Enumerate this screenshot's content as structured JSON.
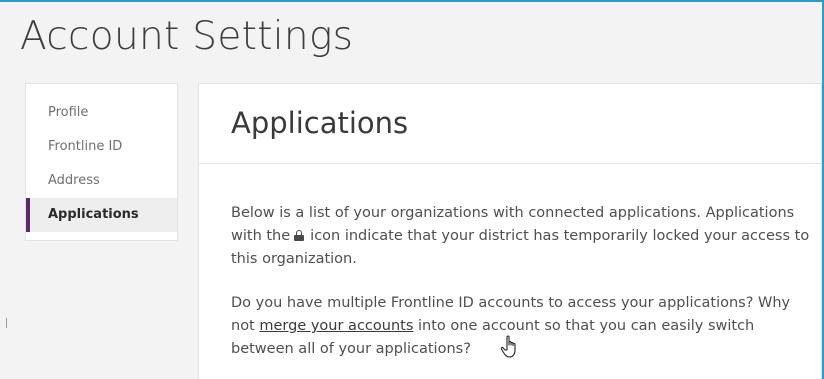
{
  "page": {
    "title": "Account Settings"
  },
  "sidebar": {
    "items": [
      {
        "label": "Profile",
        "active": false
      },
      {
        "label": "Frontline ID",
        "active": false
      },
      {
        "label": "Address",
        "active": false
      },
      {
        "label": "Applications",
        "active": true
      }
    ]
  },
  "panel": {
    "title": "Applications",
    "para1": {
      "before_icon": "Below is a list of your organizations with connected applications. Applications with the",
      "icon": "lock-icon",
      "after_icon": "icon indicate that your district has temporarily locked your access to this organization."
    },
    "para2": {
      "before_link": "Do you have multiple Frontline ID accounts to access your applications? Why not ",
      "link": "merge your accounts",
      "after_link": " into one account so that you can easily switch between all of your applications?"
    }
  },
  "colors": {
    "accent_border": "#2d9bd1",
    "active_indicator": "#5a2a6a",
    "background": "#f3f3f3"
  }
}
